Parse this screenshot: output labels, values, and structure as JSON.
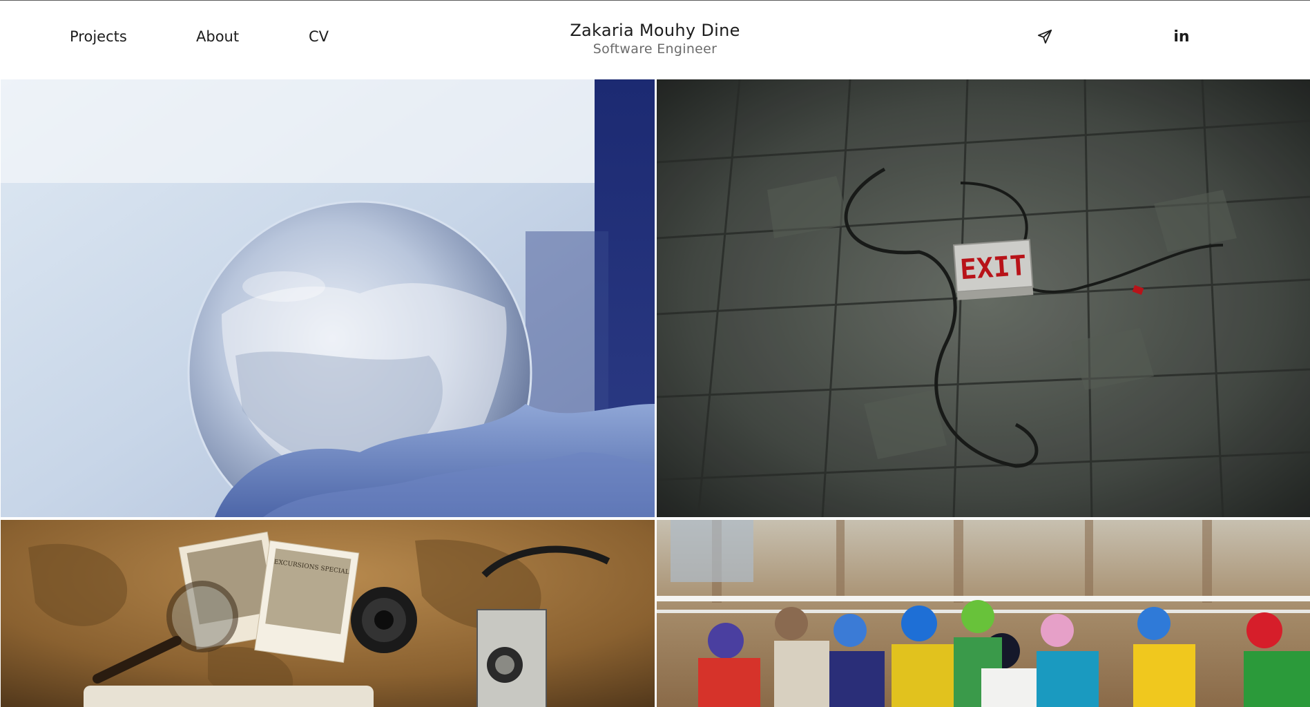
{
  "nav": {
    "projects": "Projects",
    "about": "About",
    "cv": "CV"
  },
  "brand": {
    "name": "Zakaria Mouhy Dine",
    "subtitle": "Software Engineer"
  },
  "social": {
    "telegram_icon": "paper-plane-icon",
    "linkedin_label": "in"
  },
  "gallery": {
    "exit_sign_text": "EXIT",
    "postcard_text": "EXCURSIONS SPECIAL"
  },
  "colors": {
    "text": "#1c1c1c",
    "subtext": "#6b6b6b",
    "background": "#ffffff"
  }
}
